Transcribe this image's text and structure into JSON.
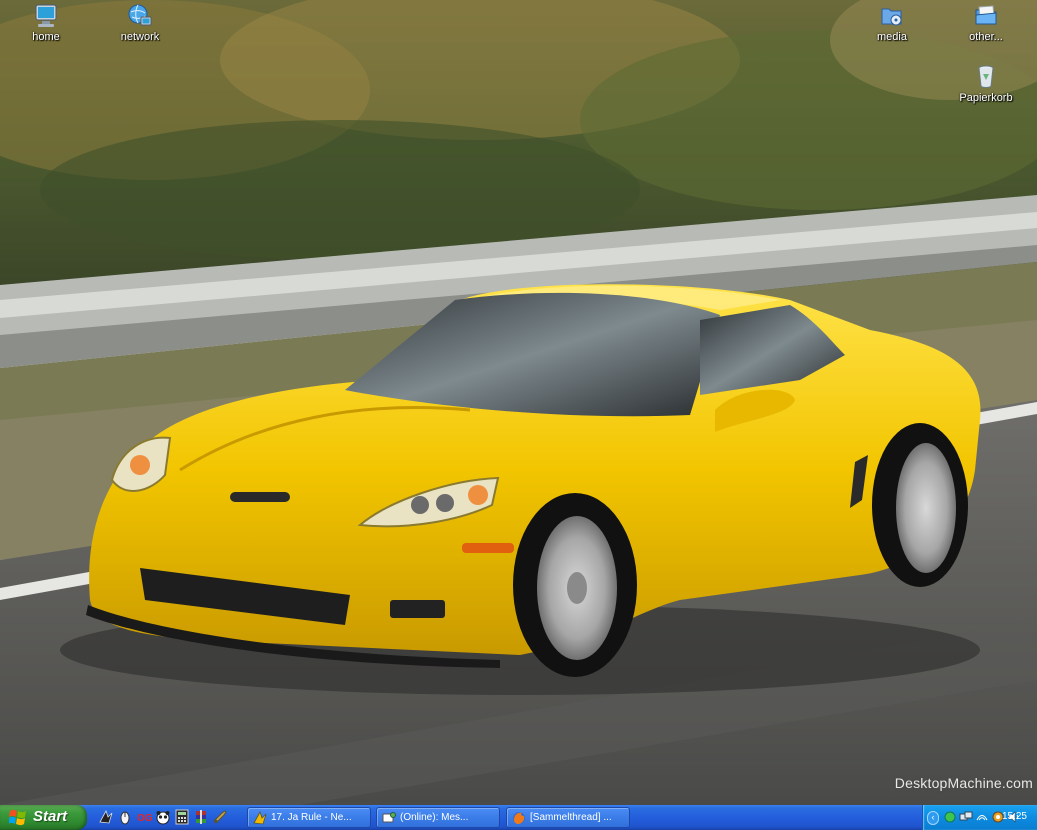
{
  "desktop": {
    "icons": [
      {
        "label": "home"
      },
      {
        "label": "network"
      },
      {
        "label": "media"
      },
      {
        "label": "other..."
      },
      {
        "label": "Papierkorb"
      }
    ],
    "watermark": "DesktopMachine.com"
  },
  "taskbar": {
    "start_label": "Start",
    "quicklaunch_icons": [
      "winamp-icon",
      "mouse-icon",
      "og-icon",
      "panda-icon",
      "calculator-icon",
      "winrar-icon",
      "tool-icon"
    ],
    "tasks": [
      {
        "label": "17. Ja Rule - Ne...",
        "icon": "winamp-icon"
      },
      {
        "label": "(Online): Mes...",
        "icon": "messenger-icon"
      },
      {
        "label": "[Sammelthread] ...",
        "icon": "firefox-icon"
      }
    ],
    "tray": {
      "clock": "15:25"
    }
  },
  "colors": {
    "taskbar_blue": "#245edc",
    "start_green": "#3c9b3c",
    "tray_blue": "#0c8be1",
    "car_yellow": "#f2c800"
  }
}
